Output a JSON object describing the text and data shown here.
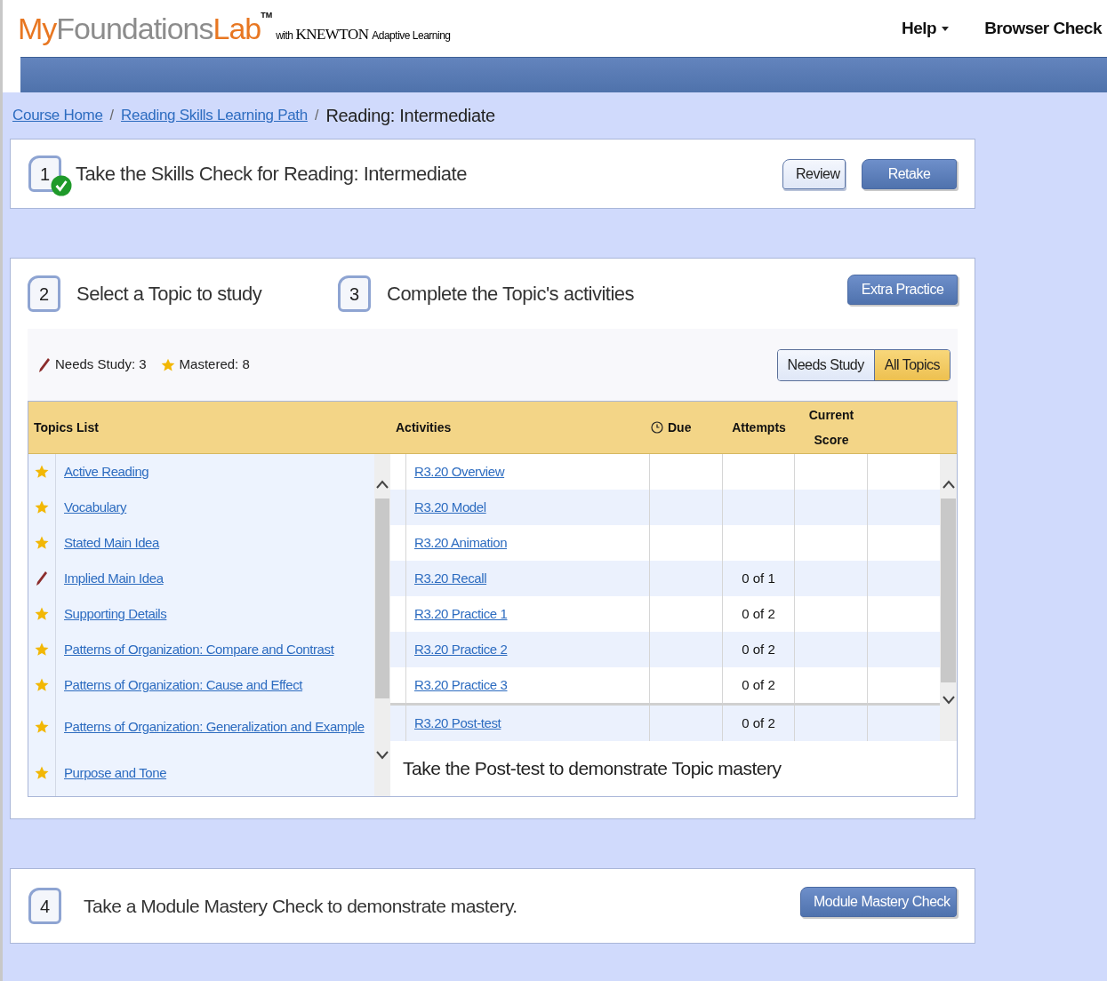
{
  "header": {
    "logo": {
      "my": "My",
      "foundations": "Foundations",
      "lab": "Lab",
      "tm": "TM"
    },
    "tagline": {
      "with": "with",
      "knewton": "KNEWTON",
      "rest": "Adaptive Learning"
    },
    "nav": [
      {
        "label": "Help",
        "dropdown": true
      },
      {
        "label": "Browser Check",
        "dropdown": false
      }
    ]
  },
  "breadcrumb": [
    {
      "kind": "link",
      "label": "Course Home"
    },
    {
      "kind": "separator",
      "label": "/"
    },
    {
      "kind": "link",
      "label": "Reading Skills Learning Path"
    },
    {
      "kind": "separator",
      "label": "/"
    },
    {
      "kind": "current",
      "label": "Reading: Intermediate"
    }
  ],
  "step1": {
    "number": "1",
    "completed": true,
    "title": "Take the Skills Check for Reading: Intermediate",
    "buttons": [
      {
        "label": "Review",
        "kind": "secondary"
      },
      {
        "label": "Retake",
        "kind": "primary"
      }
    ]
  },
  "step2": {
    "number": "2",
    "title": "Select a Topic to study"
  },
  "step3": {
    "number": "3",
    "title": "Complete the Topic's activities",
    "button": {
      "label": "Extra Practice",
      "kind": "primary"
    }
  },
  "summary": {
    "needs_study": "Needs Study: 3",
    "mastered": "Mastered: 8"
  },
  "filter": [
    {
      "label": "Needs Study",
      "selected": false
    },
    {
      "label": "All Topics",
      "selected": true
    }
  ],
  "table": {
    "columns": [
      "Topics List",
      "Activities",
      "Due",
      "Attempts",
      "Current Score"
    ],
    "topics": [
      {
        "name": "Active Reading",
        "mastered": true
      },
      {
        "name": "Vocabulary",
        "mastered": true
      },
      {
        "name": "Stated Main Idea",
        "mastered": true
      },
      {
        "name": "Implied Main Idea",
        "mastered": false
      },
      {
        "name": "Supporting Details",
        "mastered": true
      },
      {
        "name": "Patterns of Organization: Compare and Contrast",
        "mastered": true
      },
      {
        "name": "Patterns of Organization: Cause and Effect",
        "mastered": true
      },
      {
        "name": "Patterns of Organization: Generalization and Example",
        "mastered": true
      },
      {
        "name": "Purpose and Tone",
        "mastered": true
      }
    ],
    "activities": [
      {
        "name": "R3.20 Overview"
      },
      {
        "name": "R3.20 Model"
      },
      {
        "name": "R3.20 Animation"
      },
      {
        "name": "R3.20 Recall",
        "attempts": "0 of 1"
      },
      {
        "name": "R3.20 Practice 1",
        "attempts": "0 of 2"
      },
      {
        "name": "R3.20 Practice 2",
        "attempts": "0 of 2"
      },
      {
        "name": "R3.20 Practice 3",
        "attempts": "0 of 2"
      }
    ],
    "post_test": {
      "name": "R3.20 Post-test",
      "attempts": "0 of 2"
    },
    "message": "Take the Post-test to demonstrate Topic mastery"
  },
  "step4": {
    "number": "4",
    "title": "Take a Module Mastery Check to demonstrate mastery.",
    "button": {
      "label": "Module Mastery Check",
      "kind": "primary"
    }
  }
}
